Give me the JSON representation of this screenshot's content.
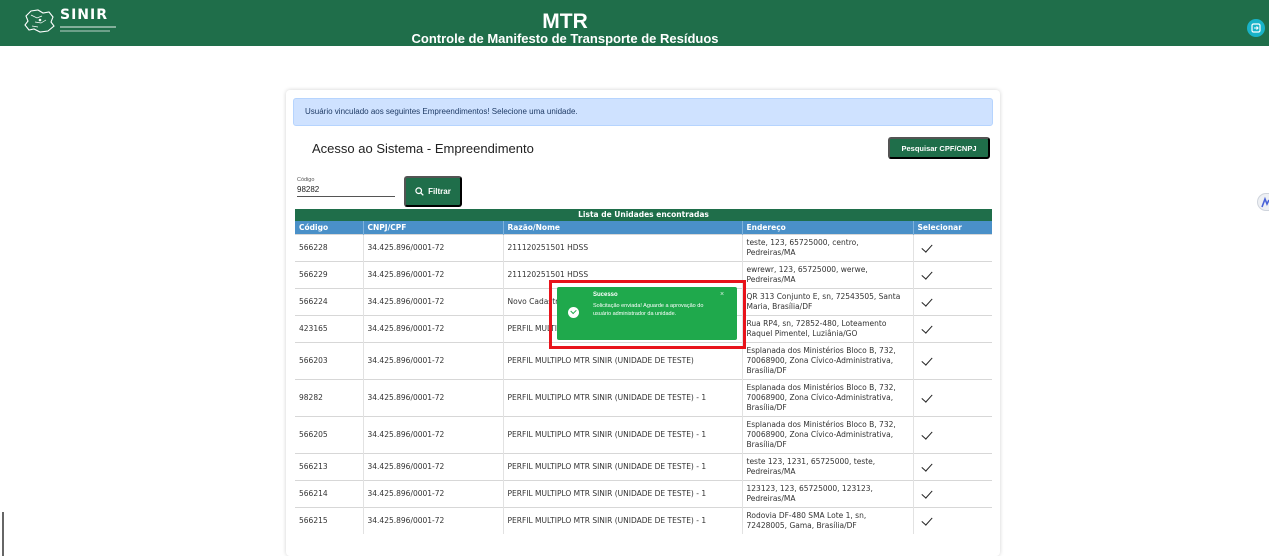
{
  "header": {
    "logo_text": "SINIR",
    "title": "MTR",
    "subtitle": "Controle de Manifesto de Transporte de Resíduos",
    "brand_color": "#1f6e4a",
    "exit_icon": "logout-icon"
  },
  "alert": {
    "text": "Usuário vinculado aos seguintes Empreendimentos! Selecione uma unidade."
  },
  "page": {
    "section_title": "Acesso ao Sistema - Empreendimento",
    "search_button_label": "Pesquisar CPF/CNPJ"
  },
  "filter": {
    "code_label": "Código",
    "code_value": "98282",
    "button_label": "Filtrar",
    "button_icon": "search-icon"
  },
  "table": {
    "caption": "Lista de Unidades encontradas",
    "columns": [
      "Código",
      "CNPJ/CPF",
      "Razão/Nome",
      "Endereço",
      "Selecionar"
    ],
    "rows": [
      {
        "code": "566228",
        "cnpj": "34.425.896/0001-72",
        "name": "211120251501 HDSS",
        "address": "teste, 123, 65725000, centro, Pedreiras/MA"
      },
      {
        "code": "566229",
        "cnpj": "34.425.896/0001-72",
        "name": "211120251501 HDSS",
        "address": "ewrewr, 123, 65725000, werwe, Pedreiras/MA"
      },
      {
        "code": "566224",
        "cnpj": "34.425.896/0001-72",
        "name": "Novo Cadastro",
        "address": "QR 313 Conjunto E, sn, 72543505, Santa Maria, Brasília/DF"
      },
      {
        "code": "423165",
        "cnpj": "34.425.896/0001-72",
        "name": "PERFIL MULTIPLO MTR SINIR (UNIDADE DE TESTE)",
        "address": "Rua RP4, sn, 72852-480, Loteamento Raquel Pimentel, Luziânia/GO"
      },
      {
        "code": "566203",
        "cnpj": "34.425.896/0001-72",
        "name": "PERFIL MULTIPLO MTR SINIR (UNIDADE DE TESTE)",
        "address": "Esplanada dos Ministérios Bloco B, 732, 70068900, Zona Cívico-Administrativa, Brasília/DF"
      },
      {
        "code": "98282",
        "cnpj": "34.425.896/0001-72",
        "name": "PERFIL MULTIPLO MTR SINIR (UNIDADE DE TESTE) - 1",
        "address": "Esplanada dos Ministérios Bloco B, 732, 70068900, Zona Cívico-Administrativa, Brasília/DF"
      },
      {
        "code": "566205",
        "cnpj": "34.425.896/0001-72",
        "name": "PERFIL MULTIPLO MTR SINIR (UNIDADE DE TESTE) - 1",
        "address": "Esplanada dos Ministérios Bloco B, 732, 70068900, Zona Cívico-Administrativa, Brasília/DF"
      },
      {
        "code": "566213",
        "cnpj": "34.425.896/0001-72",
        "name": "PERFIL MULTIPLO MTR SINIR (UNIDADE DE TESTE) - 1",
        "address": "teste 123, 1231, 65725000, teste, Pedreiras/MA"
      },
      {
        "code": "566214",
        "cnpj": "34.425.896/0001-72",
        "name": "PERFIL MULTIPLO MTR SINIR (UNIDADE DE TESTE) - 1",
        "address": "123123, 123, 65725000, 123123, Pedreiras/MA"
      },
      {
        "code": "566215",
        "cnpj": "34.425.896/0001-72",
        "name": "PERFIL MULTIPLO MTR SINIR (UNIDADE DE TESTE) - 1",
        "address": "Rodovia DF-480 SMA Lote 1, sn, 72428005, Gama, Brasília/DF"
      }
    ]
  },
  "toast": {
    "title": "Sucesso",
    "message": "Solicitação enviada! Aguarde a aprovação do usuário administrador da unidade.",
    "close_symbol": "×",
    "color": "#1fa94c",
    "highlight_color": "#e8131b"
  }
}
